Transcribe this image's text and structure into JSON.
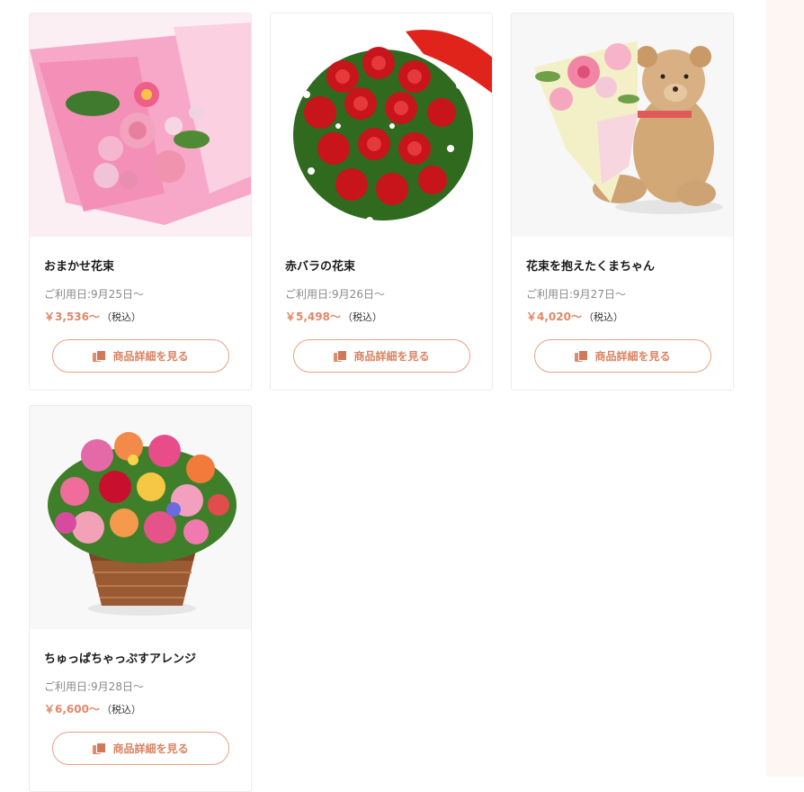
{
  "button_label": "商品詳細を見る",
  "accent_color": "#e0896a",
  "products": [
    {
      "name": "おまかせ花束",
      "date": "ご利用日:9月25日〜",
      "price": "￥3,536〜",
      "tax": "（税込）",
      "image": "pink-bouquet"
    },
    {
      "name": "赤バラの花束",
      "date": "ご利用日:9月26日〜",
      "price": "￥5,498〜",
      "tax": "（税込）",
      "image": "red-rose-bouquet"
    },
    {
      "name": "花束を抱えたくまちゃん",
      "date": "ご利用日:9月27日〜",
      "price": "￥4,020〜",
      "tax": "（税込）",
      "image": "teddy-bear-bouquet"
    },
    {
      "name": "ちゅっぱちゃっぷすアレンジ",
      "date": "ご利用日:9月28日〜",
      "price": "￥6,600〜",
      "tax": "（税込）",
      "image": "basket-arrangement"
    }
  ]
}
